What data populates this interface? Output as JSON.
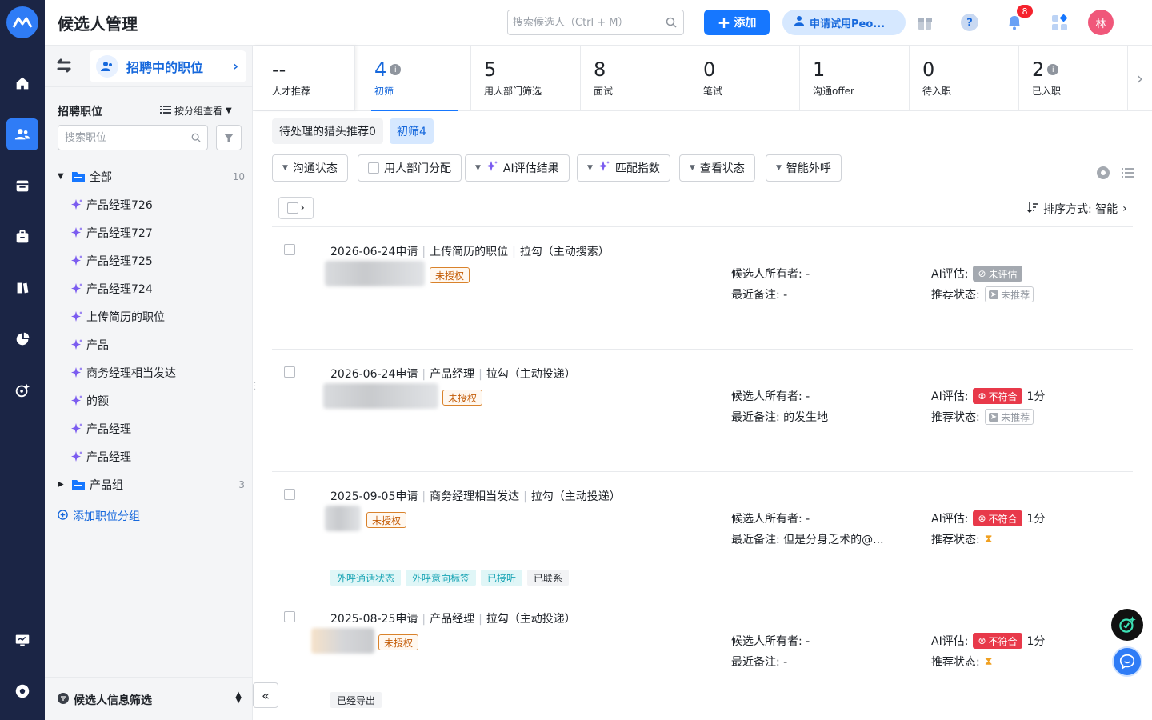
{
  "header": {
    "title": "候选人管理",
    "search_placeholder": "搜索候选人（Ctrl + M）",
    "add_label": "添加",
    "trial_label": "申请试用Peo...",
    "notification_count": "8",
    "avatar_text": "林"
  },
  "sidebar": {
    "tab_label": "招聘中的职位",
    "section_title": "招聘职位",
    "group_view_label": "按分组查看",
    "job_search_placeholder": "搜索职位",
    "tree_all": {
      "label": "全部",
      "count": "10"
    },
    "jobs": [
      "产品经理726",
      "产品经理727",
      "产品经理725",
      "产品经理724",
      "上传简历的职位",
      "产品",
      "商务经理相当发达",
      "的额",
      "产品经理",
      "产品经理"
    ],
    "tree_group": {
      "label": "产品组",
      "count": "3"
    },
    "add_group_label": "添加职位分组",
    "bottom_filter_label": "候选人信息筛选"
  },
  "stages": [
    {
      "num": "--",
      "name": "人才推荐"
    },
    {
      "num": "4",
      "name": "初筛"
    },
    {
      "num": "5",
      "name": "用人部门筛选"
    },
    {
      "num": "8",
      "name": "面试"
    },
    {
      "num": "0",
      "name": "笔试"
    },
    {
      "num": "1",
      "name": "沟通offer"
    },
    {
      "num": "0",
      "name": "待入职"
    },
    {
      "num": "2",
      "name": "已入职"
    }
  ],
  "sub_tabs": {
    "pending_headhunter": "待处理的猎头推荐0",
    "screening": "初筛4"
  },
  "filters": {
    "communication_status": "沟通状态",
    "dept_assign": "用人部门分配",
    "ai_result": "AI评估结果",
    "match_index": "匹配指数",
    "view_status": "查看状态",
    "smart_call": "智能外呼"
  },
  "sort_label": "排序方式: 智能",
  "labels": {
    "owner": "候选人所有者:",
    "note": "最近备注:",
    "ai": "AI评估:",
    "rec": "推荐状态:",
    "unauthorized": "未授权",
    "not_evaluated": "未评估",
    "not_recommended": "未推荐",
    "not_match": "不符合"
  },
  "candidates": [
    {
      "date": "2026-06-24申请",
      "job": "上传简历的职位",
      "source": "拉勾（主动搜索）",
      "owner": "-",
      "note": "-",
      "score": ""
    },
    {
      "date": "2026-06-24申请",
      "job": "产品经理",
      "source": "拉勾（主动投递）",
      "owner": "-",
      "note": "的发生地",
      "score": "1分"
    },
    {
      "date": "2025-09-05申请",
      "job": "商务经理相当发达",
      "source": "拉勾（主动投递）",
      "owner": "-",
      "note": "但是分身乏术的@...",
      "score": "1分",
      "tags": [
        "外呼通话状态",
        "外呼意向标签",
        "已接听",
        "已联系"
      ]
    },
    {
      "date": "2025-08-25申请",
      "job": "产品经理",
      "source": "拉勾（主动投递）",
      "owner": "-",
      "note": "-",
      "score": "1分",
      "tags": [
        "已经导出"
      ]
    }
  ],
  "colors": {
    "primary": "#1677ff",
    "rail": "#1b2545",
    "danger": "#e8394a",
    "warning": "#c45d08"
  }
}
